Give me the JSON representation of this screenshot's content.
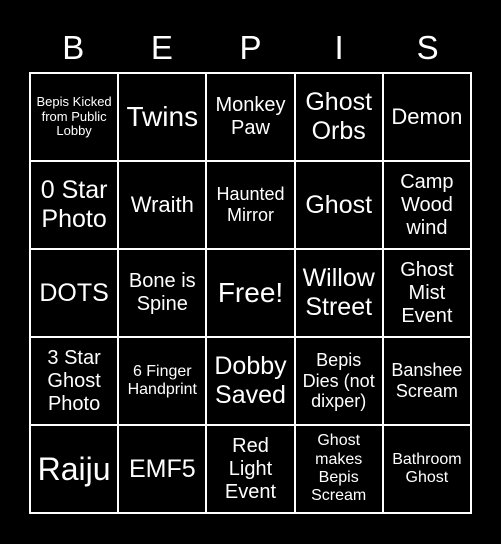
{
  "header": {
    "letters": [
      "B",
      "E",
      "P",
      "I",
      "S"
    ]
  },
  "board": {
    "cells": [
      "Bepis Kicked from Public Lobby",
      "Twins",
      "Monkey Paw",
      "Ghost Orbs",
      "Demon",
      "0 Star Photo",
      "Wraith",
      "Haunted Mirror",
      "Ghost",
      "Camp Wood wind",
      "DOTS",
      "Bone is Spine",
      "Free!",
      "Willow Street",
      "Ghost Mist Event",
      "3 Star Ghost Photo",
      "6 Finger Handprint",
      "Dobby Saved",
      "Bepis Dies (not dixper)",
      "Banshee Scream",
      "Raiju",
      "EMF5",
      "Red Light Event",
      "Ghost makes Bepis Scream",
      "Bathroom Ghost"
    ]
  },
  "colors": {
    "background": "#000000",
    "foreground": "#ffffff"
  }
}
